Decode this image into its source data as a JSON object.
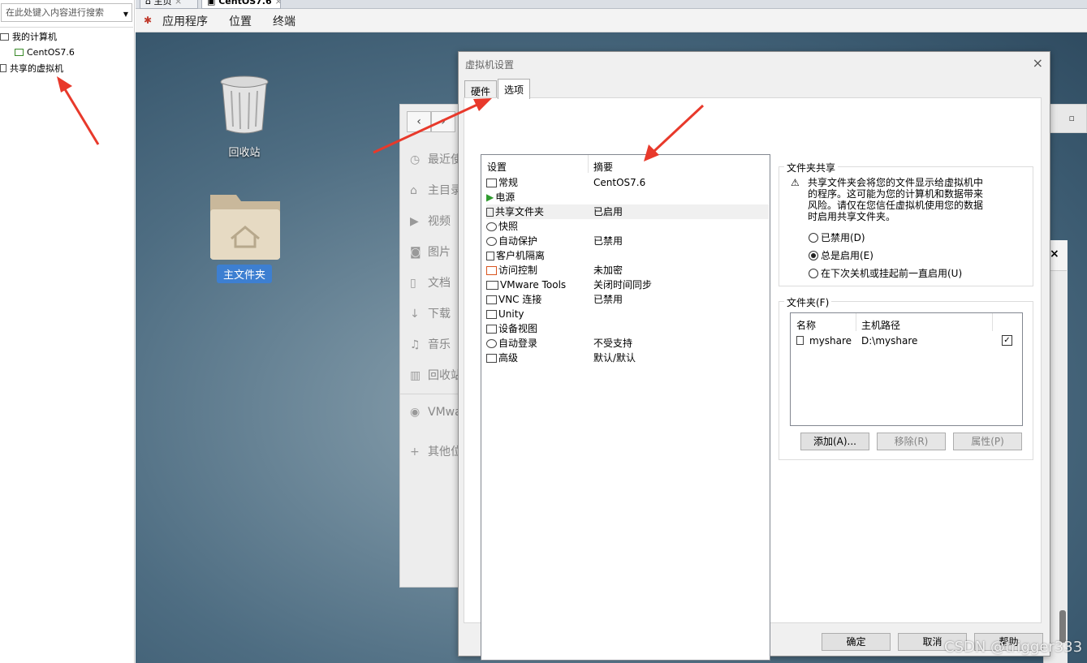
{
  "library": {
    "search_placeholder": "在此处键入内容进行搜索",
    "items": [
      "我的计算机",
      "CentOS7.6",
      "共享的虚拟机"
    ]
  },
  "tabs": [
    "主页",
    "CentOS7.6"
  ],
  "menubar": [
    "应用程序",
    "位置",
    "终端"
  ],
  "desktop": {
    "trash_label": "回收站",
    "home_label": "主文件夹"
  },
  "file_manager": {
    "items": [
      "最近使用",
      "主目录",
      "视频",
      "图片",
      "文档",
      "下载",
      "音乐",
      "回收站",
      "VMware",
      "其他位置"
    ]
  },
  "dialog": {
    "title": "虚拟机设置",
    "tabs": [
      "硬件",
      "选项"
    ],
    "list_headers": {
      "setting": "设置",
      "summary": "摘要"
    },
    "settings": [
      {
        "name": "常规",
        "summary": "CentOS7.6"
      },
      {
        "name": "电源",
        "summary": ""
      },
      {
        "name": "共享文件夹",
        "summary": "已启用"
      },
      {
        "name": "快照",
        "summary": ""
      },
      {
        "name": "自动保护",
        "summary": "已禁用"
      },
      {
        "name": "客户机隔离",
        "summary": ""
      },
      {
        "name": "访问控制",
        "summary": "未加密"
      },
      {
        "name": "VMware Tools",
        "summary": "关闭时间同步"
      },
      {
        "name": "VNC 连接",
        "summary": "已禁用"
      },
      {
        "name": "Unity",
        "summary": ""
      },
      {
        "name": "设备视图",
        "summary": ""
      },
      {
        "name": "自动登录",
        "summary": "不受支持"
      },
      {
        "name": "高级",
        "summary": "默认/默认"
      }
    ],
    "sharing": {
      "title": "文件夹共享",
      "warning": [
        "共享文件夹会将您的文件显示给虚拟机中",
        "的程序。这可能为您的计算机和数据带来",
        "风险。请仅在您信任虚拟机使用您的数据",
        "时启用共享文件夹。"
      ],
      "options": [
        "已禁用(D)",
        "总是启用(E)",
        "在下次关机或挂起前一直启用(U)"
      ],
      "selected": "总是启用(E)"
    },
    "folders": {
      "title": "文件夹(F)",
      "headers": {
        "name": "名称",
        "path": "主机路径"
      },
      "rows": [
        {
          "name": "myshare",
          "path": "D:\\myshare",
          "enabled": true
        }
      ],
      "buttons": {
        "add": "添加(A)...",
        "remove": "移除(R)",
        "props": "属性(P)"
      }
    },
    "footer": {
      "ok": "确定",
      "cancel": "取消",
      "help": "帮助"
    }
  },
  "watermark": "CSDN @trigger333"
}
